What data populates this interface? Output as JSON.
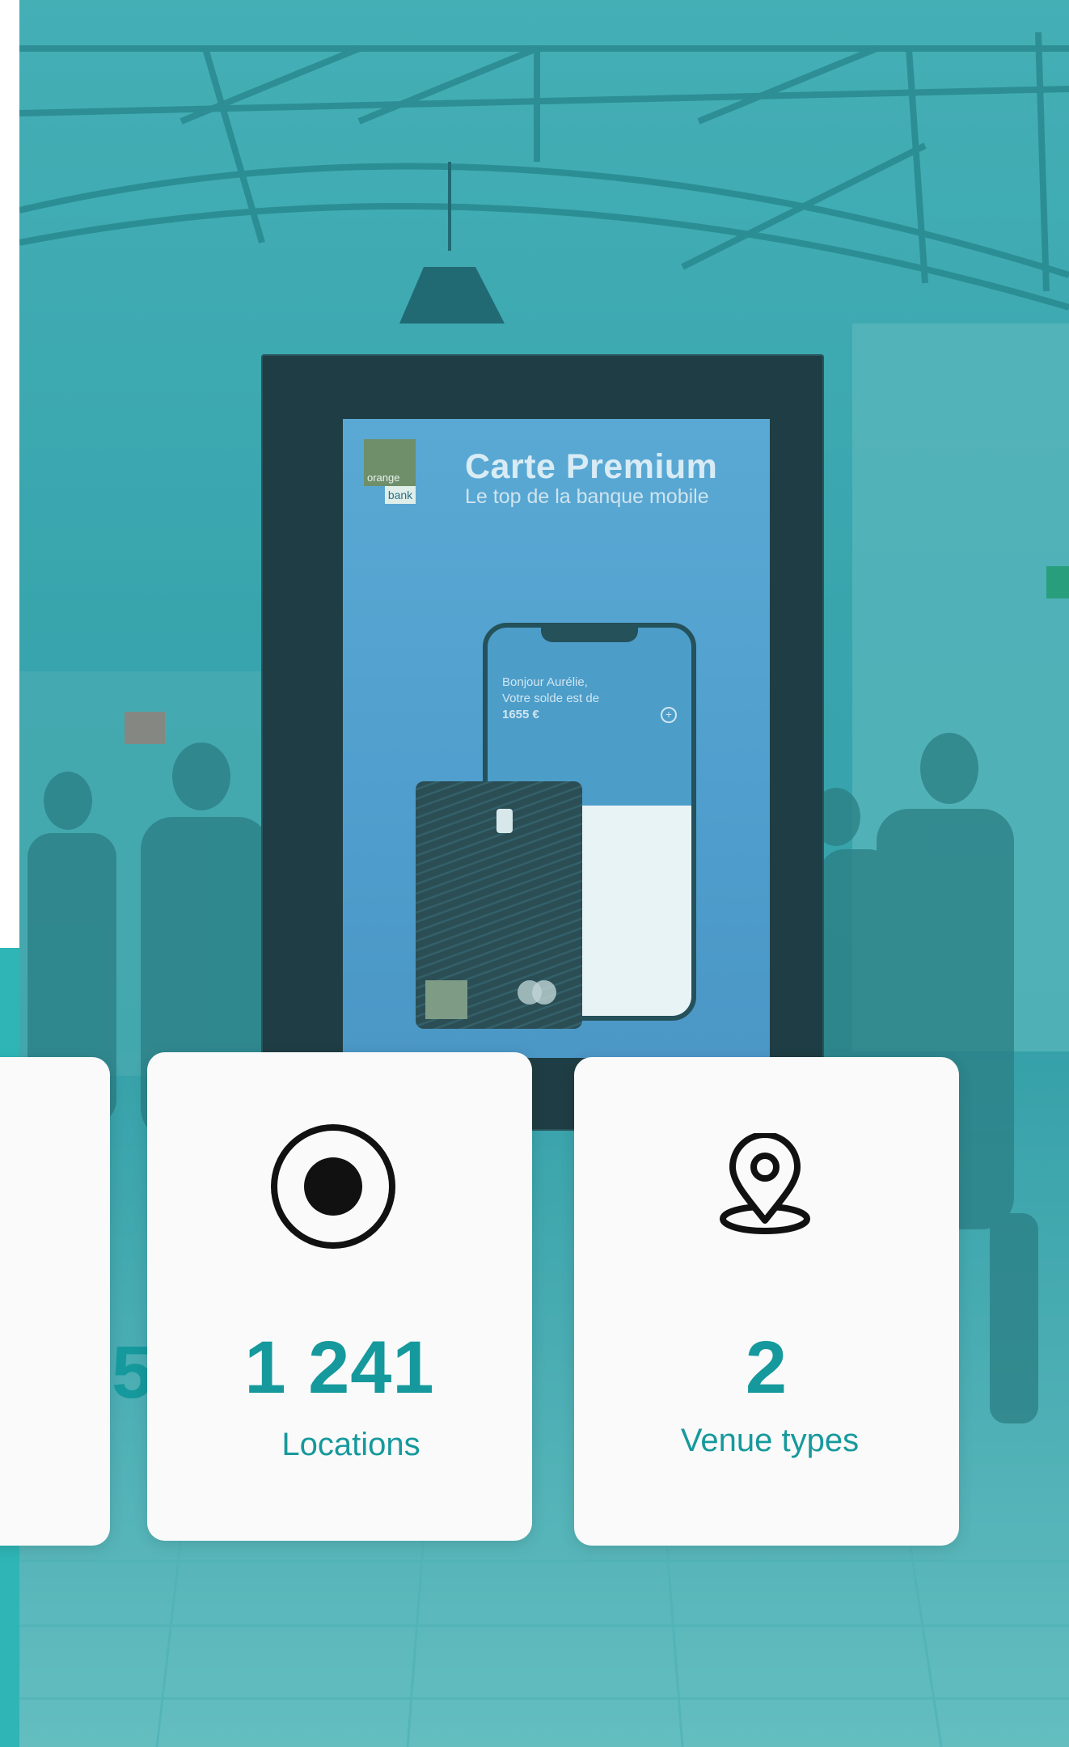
{
  "ad": {
    "brand_line1": "orange",
    "brand_line2": "bank",
    "title": "Carte Premium",
    "subtitle": "Le top de la banque mobile",
    "phone_greeting_1": "Bonjour Aurélie,",
    "phone_greeting_2": "Votre solde est de",
    "phone_balance": "1655 €"
  },
  "stats": [
    {
      "value": "5",
      "label": "",
      "icon": "partial-card"
    },
    {
      "value": "1 241",
      "label": "Locations",
      "icon": "record-circle-icon"
    },
    {
      "value": "2",
      "label": "Venue types",
      "icon": "map-pin-icon"
    }
  ],
  "colors": {
    "accent": "#16999c",
    "teal_strip": "#2fb5b6",
    "card_bg": "#fafafa"
  }
}
